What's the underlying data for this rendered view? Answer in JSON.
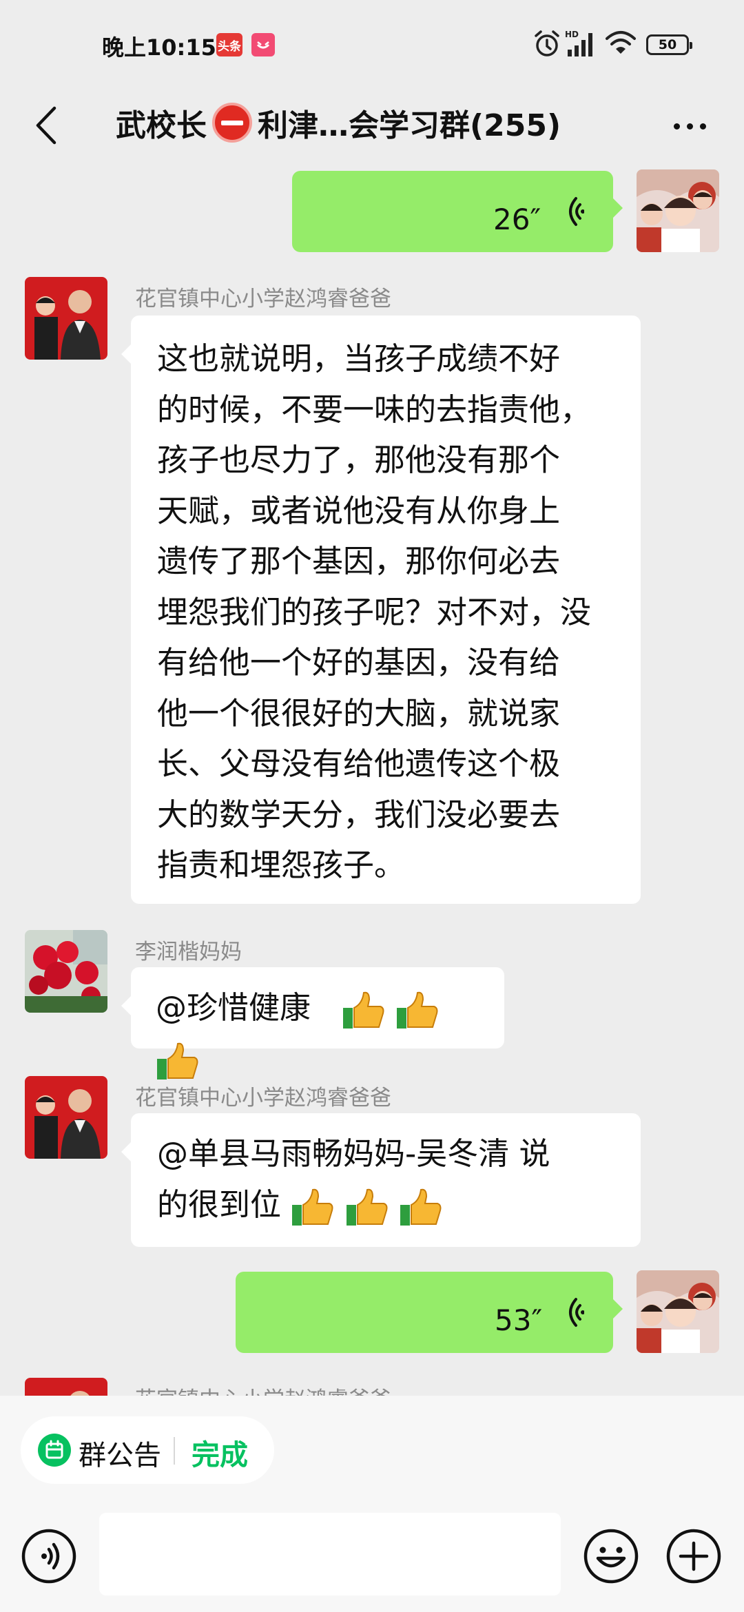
{
  "status_bar": {
    "time": "晚上10:15",
    "toutiao_badge": "头条",
    "battery": "50"
  },
  "nav": {
    "title_before": "武校长",
    "title_after": "利津…会学习群(255)"
  },
  "messages": [
    {
      "side": "right",
      "type": "voice",
      "duration": "26″"
    },
    {
      "side": "left",
      "sender": "花官镇中心小学赵鸿睿爸爸",
      "lines": [
        "这也就说明，当孩子成绩不好",
        "的时候，不要一味的去指责他，",
        "孩子也尽力了，那他没有那个",
        "天赋，或者说他没有从你身上",
        "遗传了那个基因，那你何必去",
        "埋怨我们的孩子呢？对不对，没",
        "有给他一个好的基因，没有给",
        "他一个很很好的大脑，就说家",
        "长、父母没有给他遗传这个极",
        "大的数学天分，我们没必要去",
        "指责和埋怨孩子。"
      ]
    },
    {
      "side": "left",
      "sender": "李润楷妈妈",
      "text": "@珍惜健康"
    },
    {
      "side": "left",
      "sender": "花官镇中心小学赵鸿睿爸爸",
      "line1": "@单县马雨畅妈妈-吴冬清  说",
      "line2": "的很到位"
    },
    {
      "side": "right",
      "type": "voice",
      "duration": "53″"
    },
    {
      "side": "left",
      "sender": "花官镇中心小学赵鸿睿爸爸"
    }
  ],
  "announcement": {
    "label": "群公告",
    "done": "完成"
  },
  "input": {
    "value": ""
  },
  "colors": {
    "background": "#ededed",
    "bubble_green": "#95ec69",
    "bubble_white": "#ffffff",
    "accent_green": "#07c160"
  }
}
